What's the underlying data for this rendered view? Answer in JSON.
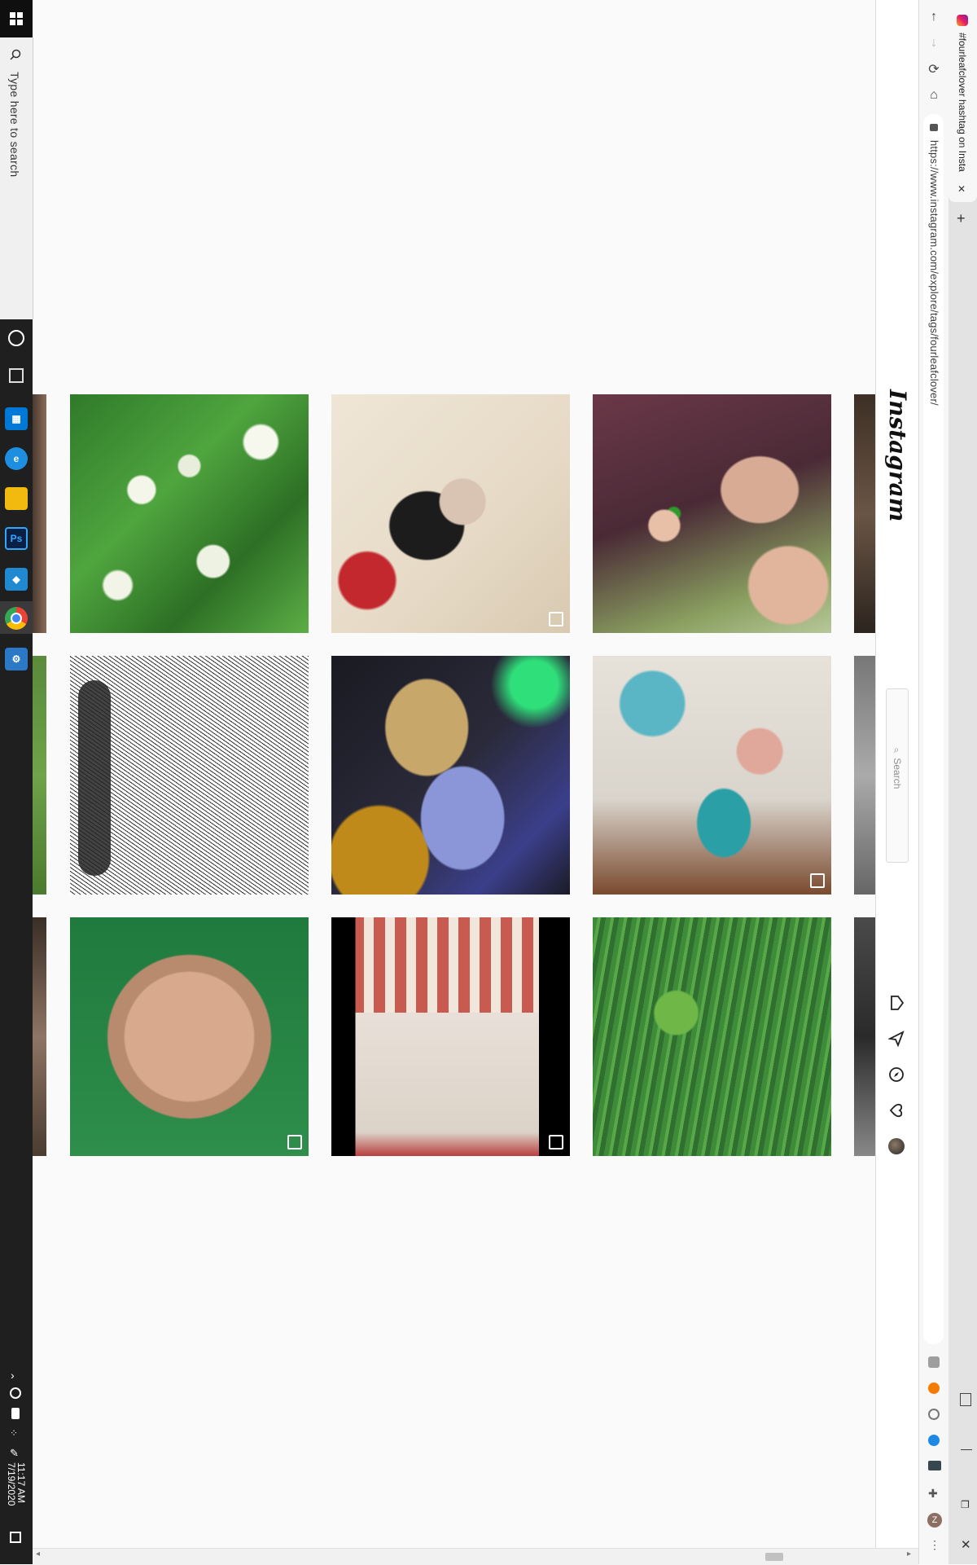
{
  "taskbar": {
    "search_placeholder": "Type here to search",
    "clock_time": "11:17 AM",
    "clock_date": "7/19/2020",
    "apps": [
      {
        "name": "store-icon",
        "color": "#0078d7"
      },
      {
        "name": "edge-icon",
        "color": "#1e8fe0"
      },
      {
        "name": "file-explorer-icon",
        "color": "#f2b90f"
      },
      {
        "name": "photoshop-icon",
        "color": "#0a1f44"
      },
      {
        "name": "vscode-icon",
        "color": "#1f8ad2"
      },
      {
        "name": "chrome-icon",
        "color": "#e94235"
      },
      {
        "name": "settings-app-icon",
        "color": "#2b78c6"
      }
    ],
    "ps_label": "Ps"
  },
  "browser": {
    "tab_title": "#fourleafclover hashtag on Insta",
    "url": "https://www.instagram.com/explore/tags/fourleafclover/",
    "new_tab_label": "+",
    "close_label": "✕"
  },
  "instagram": {
    "logo": "Instagram",
    "search_placeholder": "Search"
  },
  "posts": [
    {
      "id": "clover-flowers",
      "badge": ""
    },
    {
      "id": "tattoo-art",
      "badge": "video"
    },
    {
      "id": "couple-selfie",
      "badge": ""
    },
    {
      "id": "sketch-drawing",
      "badge": ""
    },
    {
      "id": "hourglass",
      "badge": ""
    },
    {
      "id": "collage-moon",
      "badge": "carousel"
    },
    {
      "id": "pixel-face",
      "badge": "carousel"
    },
    {
      "id": "striped-sweater",
      "badge": "video"
    },
    {
      "id": "clover-grass",
      "badge": ""
    }
  ],
  "colors": {
    "ig_bg": "#fafafa",
    "taskbar": "#1f1f1f",
    "accent": "#0078d7"
  }
}
